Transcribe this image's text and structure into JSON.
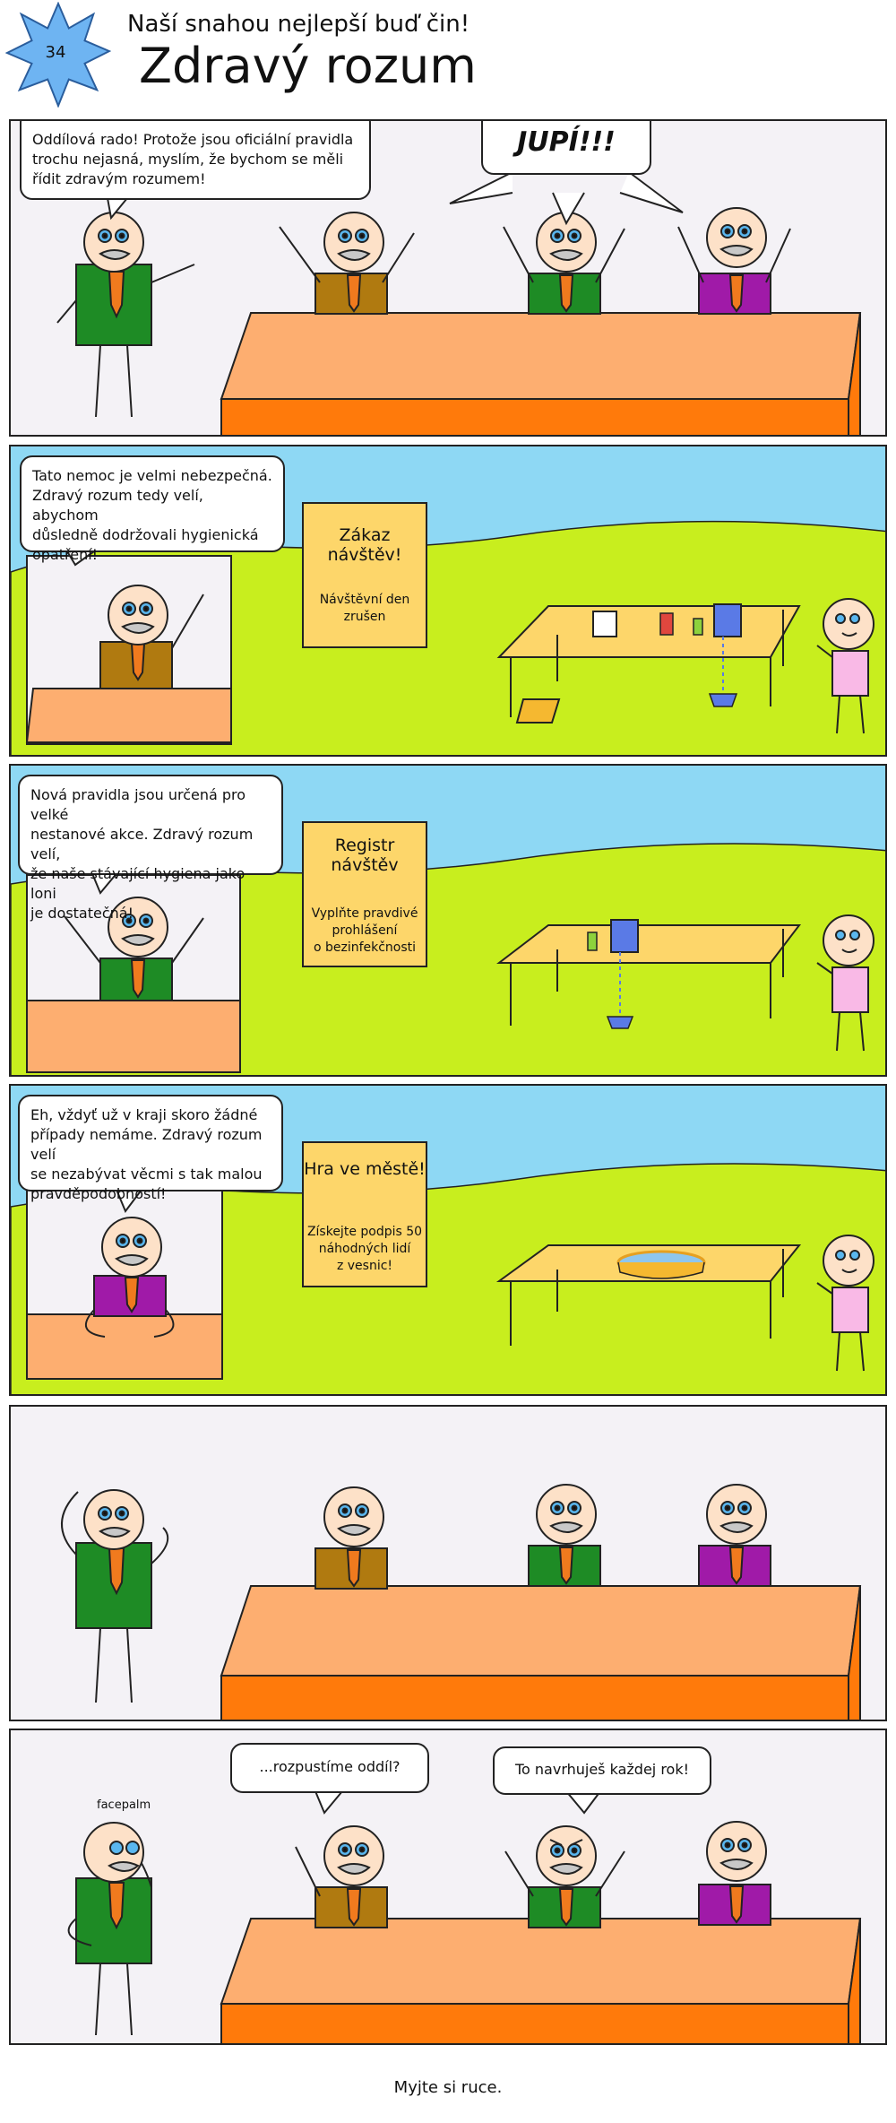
{
  "header": {
    "strip_number": "34",
    "motto": "Naší snahou nejlepší buď čin!",
    "title": "Zdravý rozum"
  },
  "panels": [
    {
      "bubbles": [
        "Oddílová rado! Protože jsou oficiální pravidla\ntrochu nejasná, myslím, že bychom se měli\nřídit zdravým rozumem!",
        "JUPÍ!!!"
      ]
    },
    {
      "bubble": "Tato nemoc je velmi nebezpečná.\nZdravý rozum tedy velí, abychom\ndůsledně dodržovali hygienická\nopatření!",
      "sign_title": "Zákaz návštěv!",
      "sign_text": "Návštěvní den\nzrušen"
    },
    {
      "bubble": "Nová pravidla jsou určená pro velké\nnestanové akce. Zdravý rozum velí,\nže naše stávající hygiena jako loni\nje dostatečná!",
      "sign_title": "Registr návštěv",
      "sign_text": "Vyplňte pravdivé\nprohlášení\no bezinfekčnosti"
    },
    {
      "bubble": "Eh, vždyť už v kraji skoro žádné\npřípady nemáme. Zdravý rozum velí\nse nezabývat věcmi s tak malou\npravděpodobností!",
      "sign_title": "Hra ve městě!",
      "sign_text": "Získejte podpis 50\nnáhodných lidí\nz vesnic!"
    },
    {},
    {
      "note": "facepalm",
      "bubbles": [
        "...rozpustíme oddíl?",
        "To navrhuješ každej rok!"
      ]
    }
  ],
  "footer": "Myjte si ruce.",
  "colors": {
    "sky": "#8ed8f4",
    "grass": "#c8ee1e",
    "hills": "#bfe61a",
    "table_top": "#fdae70",
    "table_side": "#ff7a0b",
    "sign": "#fdd66a",
    "shirt_green": "#1e8b25",
    "shirt_brown": "#b07a10",
    "shirt_purple": "#a01aa8",
    "shirt_pink": "#f9b9e6",
    "scarf": "#f07a1e",
    "skin": "#fde1c8",
    "badge_star": "#6eb4f2",
    "room_bg": "#f4f2f6"
  }
}
